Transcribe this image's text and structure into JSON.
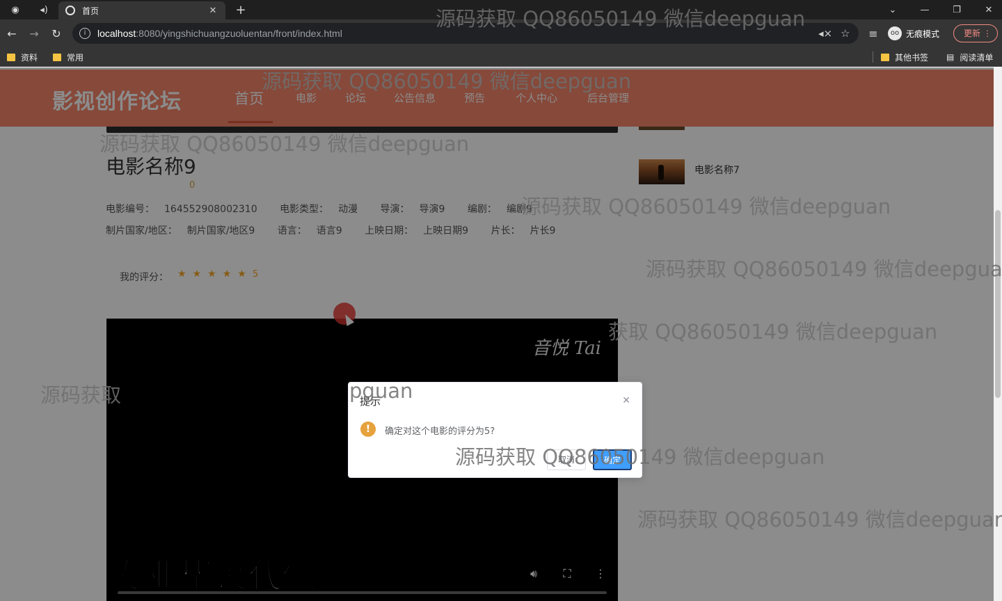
{
  "browser": {
    "tab_title": "首页",
    "url_host": "localhost",
    "url_rest": ":8080/yingshichuangzuoluentan/front/index.html",
    "incognito_label": "无痕模式",
    "update_label": "更新",
    "bookmarks": [
      "资料",
      "常用"
    ],
    "other_bookmarks": "其他书签",
    "reading_list": "阅读清单"
  },
  "site": {
    "logo": "影视创作论坛",
    "nav": [
      "首页",
      "电影",
      "论坛",
      "公告信息",
      "预告",
      "个人中心",
      "后台管理"
    ]
  },
  "movie": {
    "title": "电影名称9",
    "score": "0",
    "line1": {
      "id_label": "电影编号：",
      "id_value": "164552908002310",
      "type_label": "电影类型：",
      "type_value": "动漫",
      "director_label": "导演：",
      "director_value": "导演9",
      "writer_label": "编剧：",
      "writer_value": "编剧9"
    },
    "line2": {
      "country_label": "制片国家/地区：",
      "country_value": "制片国家/地区9",
      "lang_label": "语言：",
      "lang_value": "语言9",
      "date_label": "上映日期：",
      "date_value": "上映日期9",
      "length_label": "片长：",
      "length_value": "片长9"
    },
    "my_rating_label": "我的评分：",
    "my_rating_value": "5",
    "stars_filled": 5
  },
  "sidebar": {
    "item_title": "电影名称7"
  },
  "video": {
    "signature": "音悦 Tai",
    "caption": "专业毕设代做"
  },
  "dialog": {
    "title": "提示",
    "message": "确定对这个电影的评分为5?",
    "cancel_label": "取消",
    "confirm_label": "确定"
  },
  "watermarks": [
    "源码获取 QQ86050149 微信deepguan",
    "源码获取 QQ86050149 微信deepguan",
    "源码获取 QQ86050149 微信deepguan",
    "源码获取 QQ86050149 微信deepguan",
    "源码获取 QQ86050149 微信deepgua",
    "获取 QQ86050149 微信deepguan",
    "源码获取",
    "pguan",
    "源码获取 QQ86050149 微信deepguan",
    "源码获取 QQ86050149 微信deepguar"
  ]
}
